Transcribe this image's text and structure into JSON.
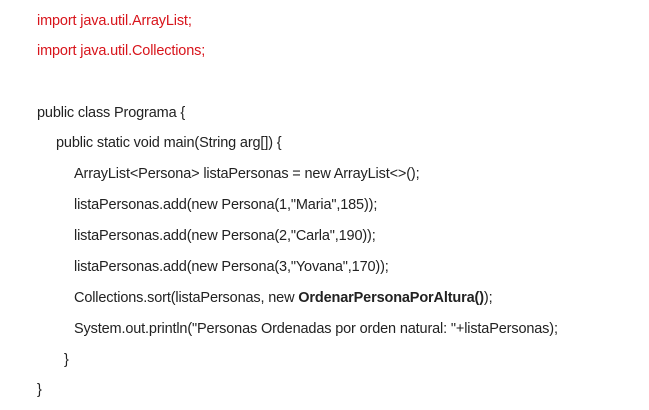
{
  "code": {
    "import_arraylist": "import java.util.ArrayList;",
    "import_collections": "import java.util.Collections;",
    "class_decl": "public class Programa {",
    "main_decl": "public static void main(String arg[]) {",
    "list_decl": "ArrayList<Persona> listaPersonas = new ArrayList<>();",
    "add_maria": "listaPersonas.add(new Persona(1,\"Maria\",185));",
    "add_carla": "listaPersonas.add(new Persona(2,\"Carla\",190));",
    "add_yovana": "listaPersonas.add(new Persona(3,\"Yovana\",170));",
    "sort_prefix": "Collections.sort(listaPersonas, new ",
    "sort_comparator": "OrdenarPersonaPorAltura()",
    "sort_suffix": ");",
    "println": "System.out.println(\"Personas Ordenadas por orden natural: \"+listaPersonas);",
    "close_method": "}",
    "close_class": "}"
  },
  "colors": {
    "import_text": "#d8141b",
    "code_text": "#222222",
    "background": "#ffffff"
  }
}
